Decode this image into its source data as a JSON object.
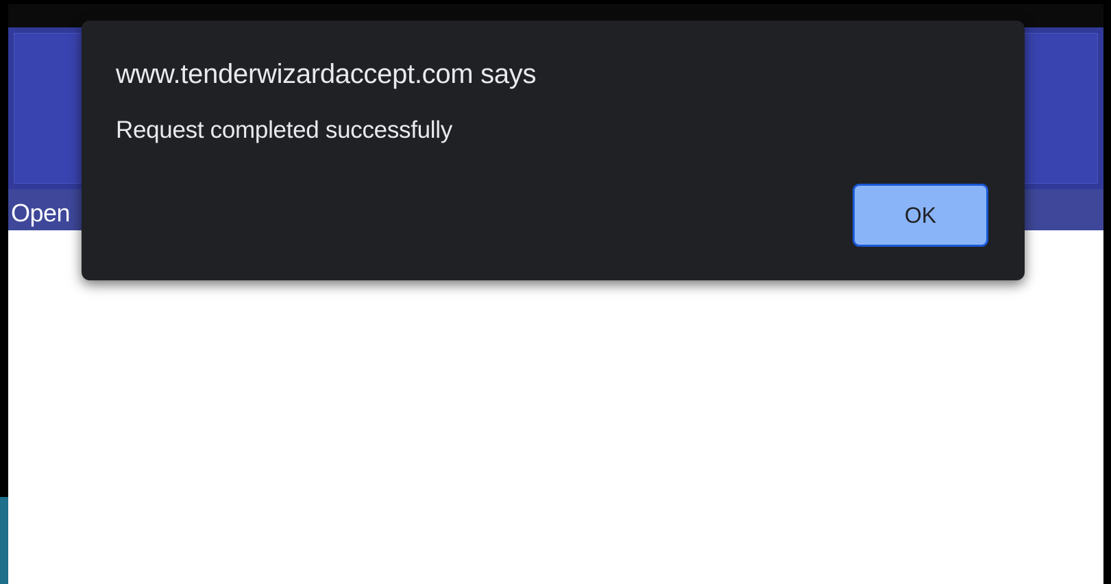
{
  "page": {
    "nav_label": "Open"
  },
  "alert": {
    "title": "www.tenderwizardaccept.com says",
    "message": "Request completed successfully",
    "ok_label": "OK"
  },
  "colors": {
    "header_background": "#313a9a",
    "dialog_background": "#202124",
    "button_fill": "#8ab4f8",
    "button_border": "#1a58d6"
  }
}
